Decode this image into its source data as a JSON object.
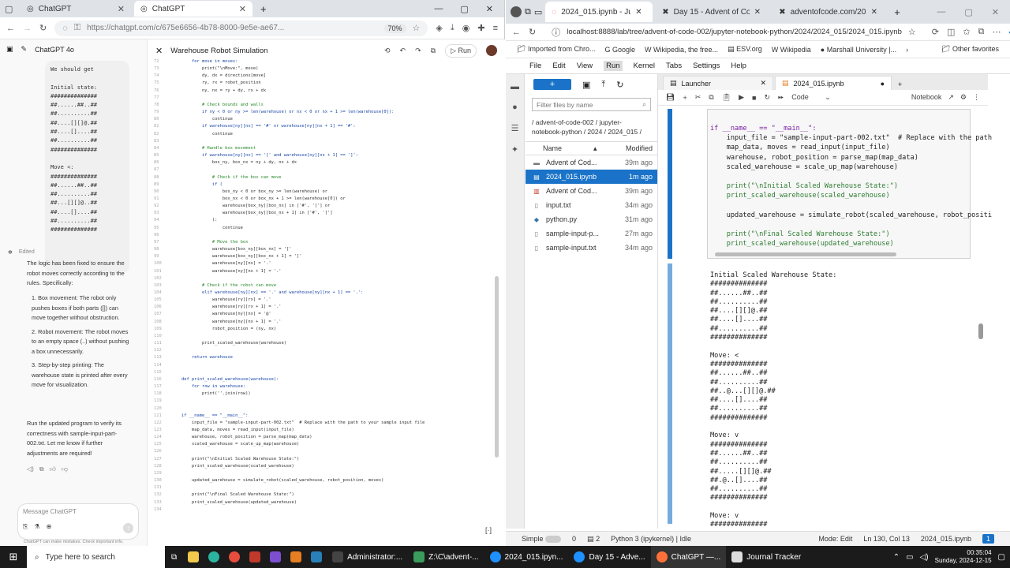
{
  "left_browser": {
    "tabs": [
      {
        "label": "ChatGPT"
      },
      {
        "label": "ChatGPT"
      }
    ],
    "url": "https://chatgpt.com/c/675e6656-4b78-8000-9e5e-ae67...",
    "zoom": "70%"
  },
  "chat": {
    "model": "ChatGPT 4o",
    "bubble_lines": [
      "We should get",
      "",
      "Initial state:",
      "##############",
      "##......##..##",
      "##..........##",
      "##....[][]@.##",
      "##....[]....##",
      "##..........##",
      "##############",
      "",
      "Move <:",
      "##############",
      "##......##..##",
      "##..........##",
      "##...[][]@..##",
      "##....[]....##",
      "##..........##",
      "##############"
    ],
    "edited": "Edited",
    "para1": "The logic has been fixed to ensure the robot moves correctly according to the rules. Specifically:",
    "list": [
      "1.  Box movement: The robot only pushes boxes if both parts ([]) can move together without obstruction.",
      "2.  Robot movement: The robot moves to an empty space (..) without pushing a box unnecessarily.",
      "3.  Step-by-step printing: The warehouse state is printed after every move for visualization."
    ],
    "para2": "Run the updated program to verify its correctness with sample-input-part-002.txt. Let me know if further adjustments are required!",
    "input_placeholder": "Message ChatGPT",
    "disclaimer": "ChatGPT can make mistakes. Check important info."
  },
  "canvas": {
    "title": "Warehouse Robot Simulation",
    "run_label": "Run",
    "lines": [
      [
        "72",
        "        for move in moves:"
      ],
      [
        "73",
        "            print(\"\\nMove:\", move)"
      ],
      [
        "74",
        "            dy, dx = directions[move]"
      ],
      [
        "75",
        "            ry, rx = robot_position"
      ],
      [
        "76",
        "            ny, nx = ry + dy, rx + dx"
      ],
      [
        "77",
        ""
      ],
      [
        "78",
        "            # Check bounds and walls"
      ],
      [
        "79",
        "            if ny < 0 or ny >= len(warehouse) or nx < 0 or nx + 1 >= len(warehouse[0]):"
      ],
      [
        "80",
        "                continue"
      ],
      [
        "81",
        "            if warehouse[ny][nx] == '#' or warehouse[ny][nx + 1] == '#':"
      ],
      [
        "82",
        "                continue"
      ],
      [
        "83",
        ""
      ],
      [
        "84",
        "            # Handle box movement"
      ],
      [
        "85",
        "            if warehouse[ny][nx] == '[' and warehouse[ny][nx + 1] == ']':"
      ],
      [
        "86",
        "                box_ny, box_nx = ny + dy, nx + dx"
      ],
      [
        "87",
        ""
      ],
      [
        "88",
        "                # Check if the box can move"
      ],
      [
        "89",
        "                if ("
      ],
      [
        "90",
        "                    box_ny < 0 or box_ny >= len(warehouse) or"
      ],
      [
        "91",
        "                    box_nx < 0 or box_nx + 1 >= len(warehouse[0]) or"
      ],
      [
        "92",
        "                    warehouse[box_ny][box_nx] in ['#', '['] or"
      ],
      [
        "93",
        "                    warehouse[box_ny][box_nx + 1] in ['#', ']']"
      ],
      [
        "94",
        "                ):"
      ],
      [
        "95",
        "                    continue"
      ],
      [
        "96",
        ""
      ],
      [
        "97",
        "                # Move the box"
      ],
      [
        "98",
        "                warehouse[box_ny][box_nx] = '['"
      ],
      [
        "99",
        "                warehouse[box_ny][box_nx + 1] = ']'"
      ],
      [
        "100",
        "                warehouse[ny][nx] = '.'"
      ],
      [
        "101",
        "                warehouse[ny][nx + 1] = '.'"
      ],
      [
        "102",
        ""
      ],
      [
        "103",
        "            # Check if the robot can move"
      ],
      [
        "104",
        "            elif warehouse[ny][nx] == '.' and warehouse[ny][nx + 1] == '.':"
      ],
      [
        "105",
        "                warehouse[ry][rx] = '.'"
      ],
      [
        "106",
        "                warehouse[ry][rx + 1] = '.'"
      ],
      [
        "107",
        "                warehouse[ny][nx] = '@'"
      ],
      [
        "108",
        "                warehouse[ny][nx + 1] = '.'"
      ],
      [
        "109",
        "                robot_position = (ny, nx)"
      ],
      [
        "110",
        ""
      ],
      [
        "111",
        "            print_scaled_warehouse(warehouse)"
      ],
      [
        "112",
        ""
      ],
      [
        "113",
        "        return warehouse"
      ],
      [
        "114",
        ""
      ],
      [
        "115",
        ""
      ],
      [
        "116",
        "    def print_scaled_warehouse(warehouse):"
      ],
      [
        "117",
        "        for row in warehouse:"
      ],
      [
        "118",
        "            print(''.join(row))"
      ],
      [
        "119",
        ""
      ],
      [
        "120",
        ""
      ],
      [
        "121",
        "    if __name__ == \"__main__\":"
      ],
      [
        "122",
        "        input_file = \"sample-input-part-002.txt\"  # Replace with the path to your sample input file"
      ],
      [
        "123",
        "        map_data, moves = read_input(input_file)"
      ],
      [
        "124",
        "        warehouse, robot_position = parse_map(map_data)"
      ],
      [
        "125",
        "        scaled_warehouse = scale_up_map(warehouse)"
      ],
      [
        "126",
        ""
      ],
      [
        "127",
        "        print(\"\\nInitial Scaled Warehouse State:\")"
      ],
      [
        "128",
        "        print_scaled_warehouse(scaled_warehouse)"
      ],
      [
        "129",
        ""
      ],
      [
        "130",
        "        updated_warehouse = simulate_robot(scaled_warehouse, robot_position, moves)"
      ],
      [
        "131",
        ""
      ],
      [
        "132",
        "        print(\"\\nFinal Scaled Warehouse State:\")"
      ],
      [
        "133",
        "        print_scaled_warehouse(updated_warehouse)"
      ],
      [
        "134",
        ""
      ]
    ]
  },
  "right_browser": {
    "tabs": [
      {
        "label": "2024_015.ipynb - JupyterLab"
      },
      {
        "label": "Day 15 - Advent of Code 2024"
      },
      {
        "label": "adventofcode.com/2024/day/15/input"
      }
    ],
    "url": "localhost:8888/lab/tree/advent-of-code-002/jupyter-notebook-python/2024/2024_015/2024_015.ipynb",
    "bookmarks": [
      "Imported from Chro...",
      "Google",
      "Wikipedia, the free...",
      "ESV.org",
      "Wikipedia",
      "Marshall University |..."
    ],
    "other_favorites": "Other favorites"
  },
  "jupyter": {
    "menu": [
      "File",
      "Edit",
      "View",
      "Run",
      "Kernel",
      "Tabs",
      "Settings",
      "Help"
    ],
    "filter_placeholder": "Filter files by name",
    "breadcrumb": "/ advent-of-code-002 / jupyter-notebook-python / 2024 / 2024_015 /",
    "col_name": "Name",
    "col_modified": "Modified",
    "files": [
      {
        "name": "Advent of Cod...",
        "mod": "39m ago",
        "icon": "folder"
      },
      {
        "name": "2024_015.ipynb",
        "mod": "1m ago",
        "icon": "notebook",
        "selected": true
      },
      {
        "name": "Advent of Cod...",
        "mod": "39m ago",
        "icon": "pdf"
      },
      {
        "name": "input.txt",
        "mod": "34m ago",
        "icon": "file"
      },
      {
        "name": "python.py",
        "mod": "31m ago",
        "icon": "python"
      },
      {
        "name": "sample-input-p...",
        "mod": "27m ago",
        "icon": "file"
      },
      {
        "name": "sample-input.txt",
        "mod": "34m ago",
        "icon": "file"
      }
    ],
    "nb_tabs": [
      "Launcher",
      "2024_015.ipynb"
    ],
    "cell_type": "Code",
    "kernel_label": "Notebook",
    "code_lines": [
      "if __name__ == \"__main__\":",
      "    input_file = \"sample-input-part-002.txt\"  # Replace with the path",
      "    map_data, moves = read_input(input_file)",
      "    warehouse, robot_position = parse_map(map_data)",
      "    scaled_warehouse = scale_up_map(warehouse)",
      "",
      "    print(\"\\nInitial Scaled Warehouse State:\")",
      "    print_scaled_warehouse(scaled_warehouse)",
      "",
      "    updated_warehouse = simulate_robot(scaled_warehouse, robot_positi",
      "",
      "    print(\"\\nFinal Scaled Warehouse State:\")",
      "    print_scaled_warehouse(updated_warehouse)"
    ],
    "output_lines": [
      "Initial Scaled Warehouse State:",
      "##############",
      "##......##..##",
      "##..........##",
      "##....[][]@.##",
      "##....[]....##",
      "##..........##",
      "##############",
      "",
      "Move: <",
      "##############",
      "##......##..##",
      "##..........##",
      "##..@...[][]@.##",
      "##....[]....##",
      "##..........##",
      "##############",
      "",
      "Move: v",
      "##############",
      "##......##..##",
      "##..........##",
      "##.....[][]@.##",
      "##.@..[]....##",
      "##..........##",
      "##############",
      "",
      "Move: v",
      "##############"
    ],
    "status": {
      "mode": "Simple",
      "zero": "0",
      "two": "2",
      "kernel": "Python 3 (ipykernel) | Idle",
      "edit_mode": "Mode: Edit",
      "cursor": "Ln 130, Col 13",
      "file": "2024_015.ipynb",
      "count": "1"
    }
  },
  "taskbar": {
    "search": "Type here to search",
    "apps": [
      "Administrator:...",
      "Z:\\C\\advent-...",
      "2024_015.ipyn...",
      "Day 15 - Adve...",
      "ChatGPT —...",
      "Journal Tracker"
    ],
    "time": "00:35:04",
    "date": "Sunday, 2024-12-15"
  }
}
